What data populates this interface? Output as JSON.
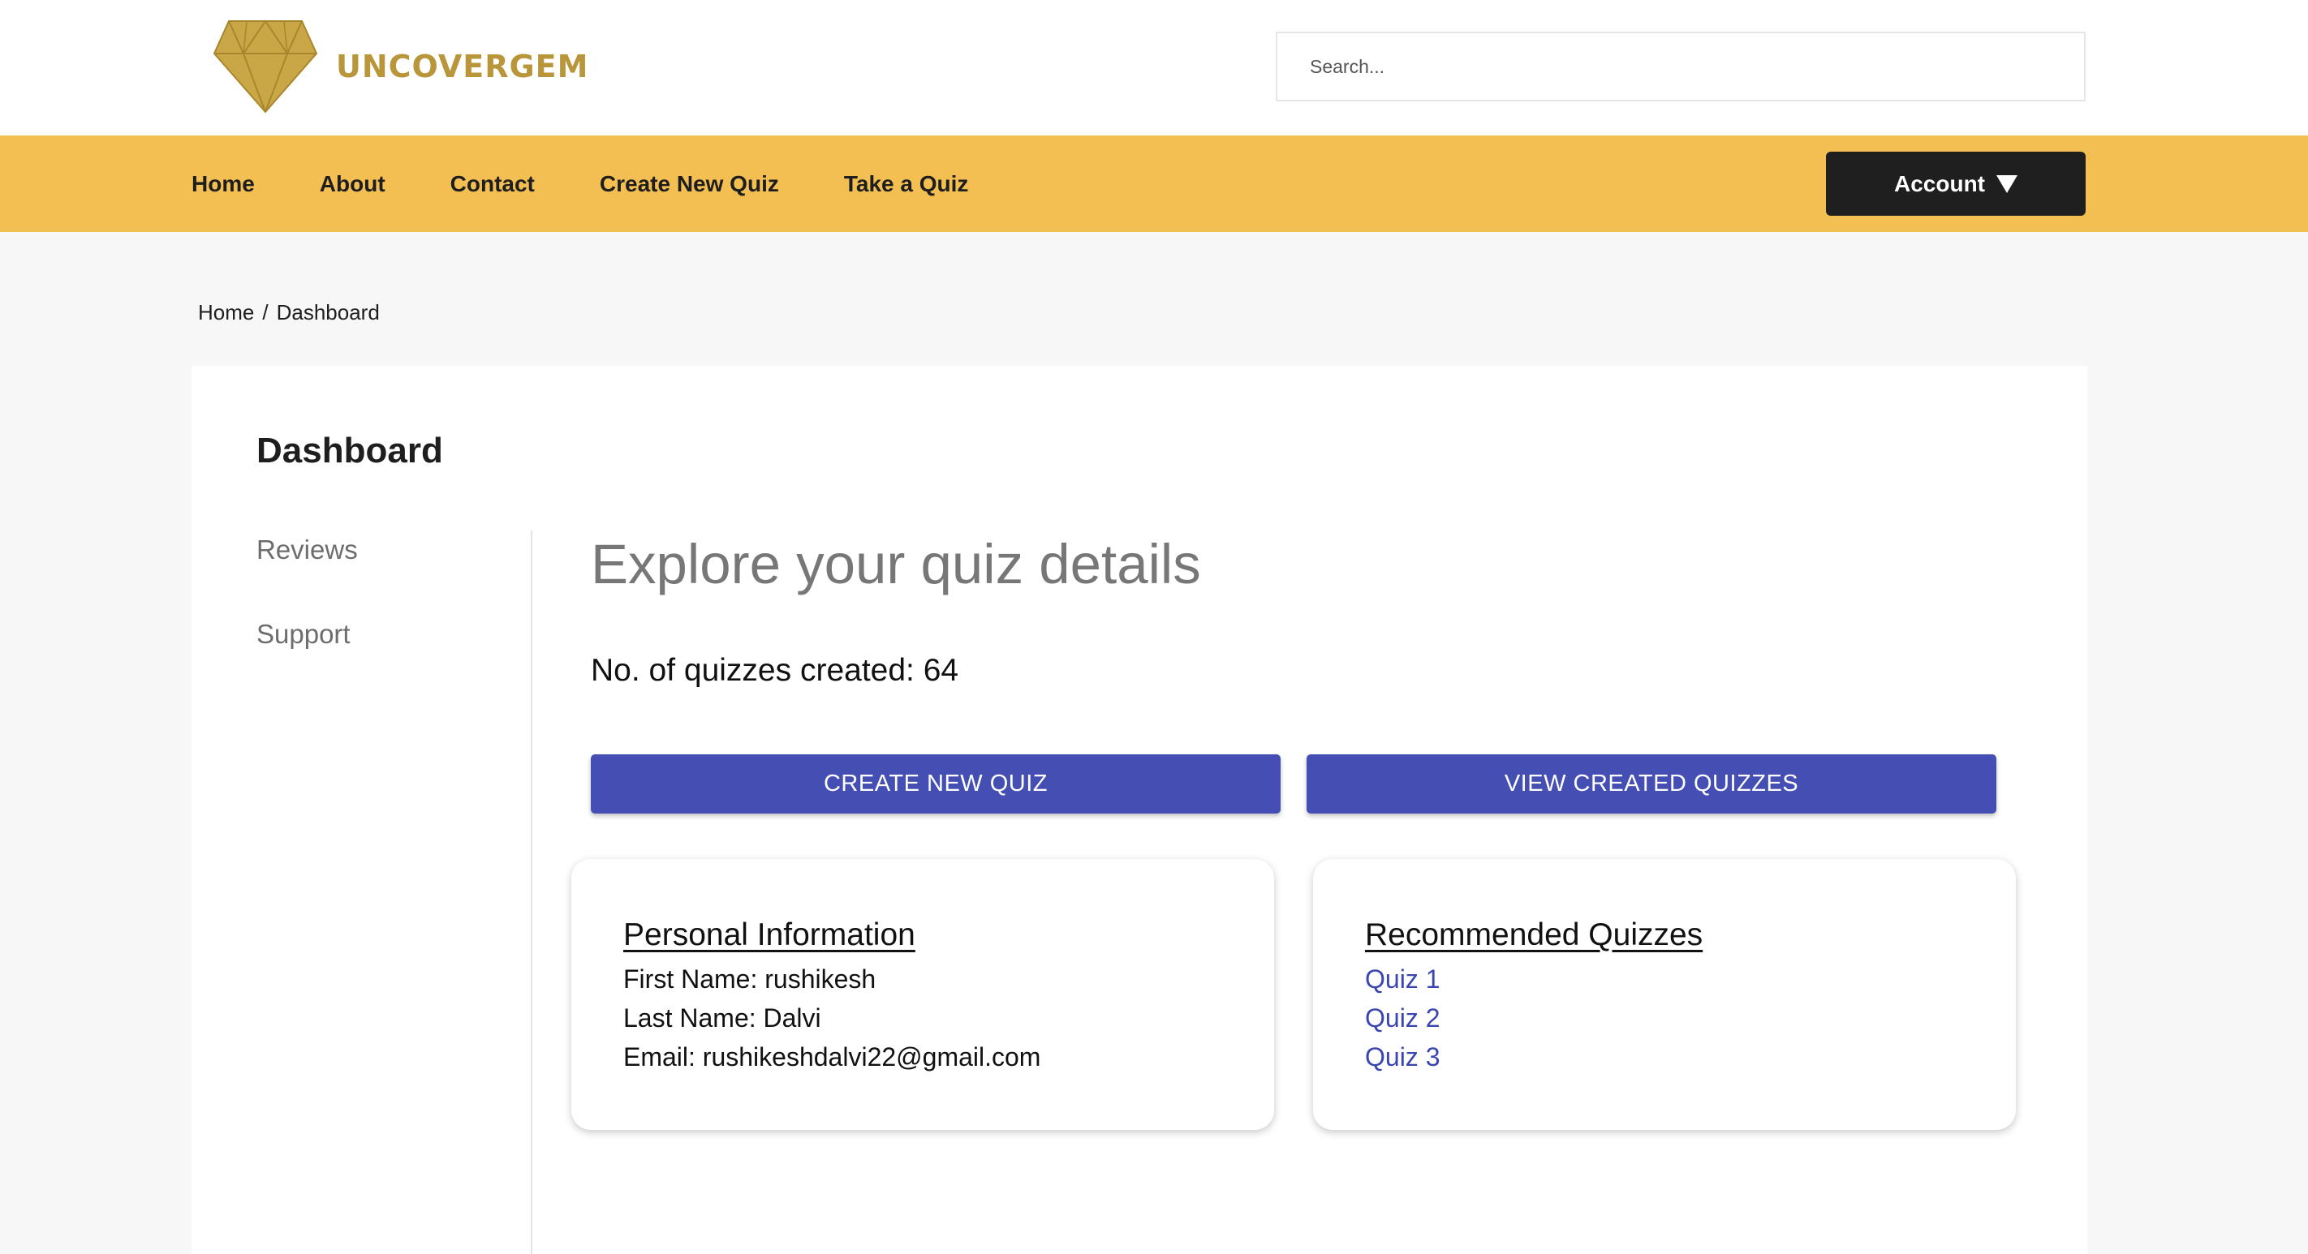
{
  "brand": {
    "name": "UNCOVERGEM",
    "logo_icon": "diamond-icon",
    "color": "#b9963a"
  },
  "search": {
    "placeholder": "Search...",
    "value": ""
  },
  "nav": {
    "background": "#f3be52",
    "items": [
      {
        "label": "Home"
      },
      {
        "label": "About"
      },
      {
        "label": "Contact"
      },
      {
        "label": "Create New Quiz"
      },
      {
        "label": "Take a Quiz"
      }
    ],
    "account_label": "Account",
    "account_icon": "caret-down-icon"
  },
  "breadcrumb": {
    "home": "Home",
    "separator": "/",
    "current": "Dashboard"
  },
  "dashboard": {
    "title": "Dashboard",
    "sidebar": {
      "items": [
        {
          "label": "Reviews"
        },
        {
          "label": "Support"
        }
      ]
    },
    "heading": "Explore your quiz details",
    "quiz_count_label": "No. of quizzes created: 64",
    "buttons": {
      "create_label": "CREATE NEW QUIZ",
      "view_label": "VIEW CREATED QUIZZES",
      "color": "#454fb3"
    },
    "personal_info": {
      "title": "Personal Information",
      "first_name": "First Name: rushikesh",
      "last_name": "Last Name: Dalvi",
      "email": "Email: rushikeshdalvi22@gmail.com"
    },
    "recommended": {
      "title": "Recommended Quizzes",
      "items": [
        {
          "label": "Quiz 1"
        },
        {
          "label": "Quiz 2"
        },
        {
          "label": "Quiz 3"
        }
      ],
      "link_color": "#3a46b0"
    }
  }
}
